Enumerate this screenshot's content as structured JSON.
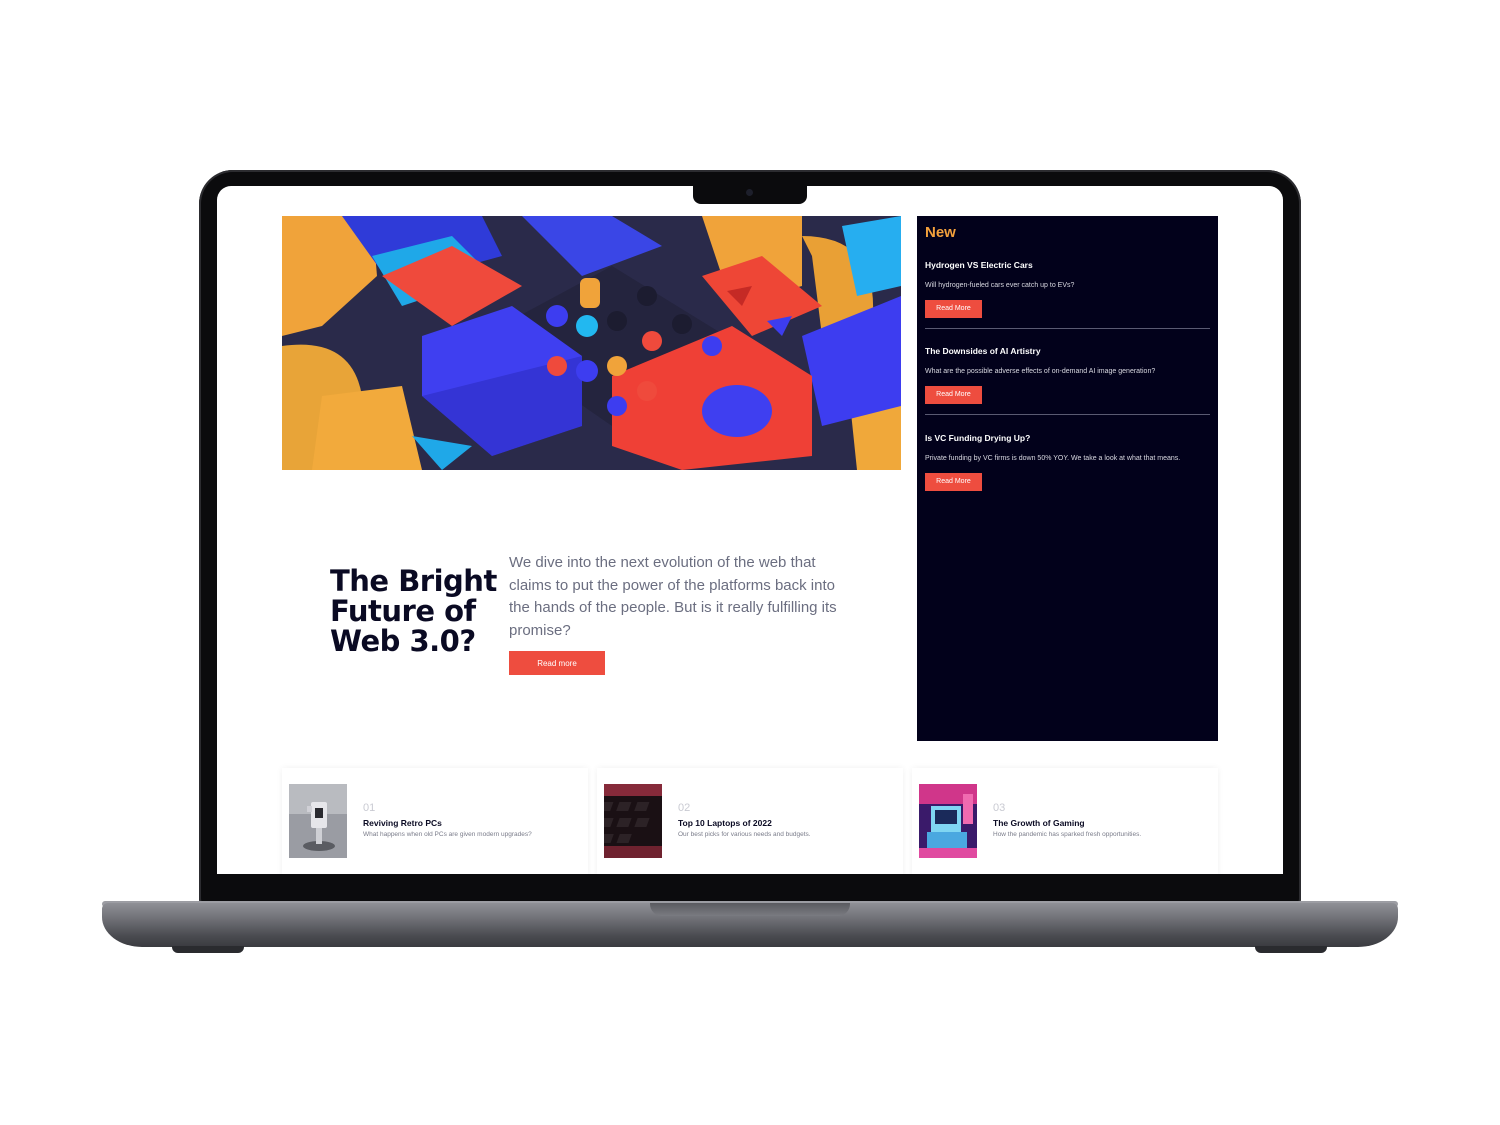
{
  "hero": {
    "title": "The Bright Future of Web 3.0?",
    "description": "We dive into the next evolution of the web that claims to put the power of the platforms back into the hands of the people. But is it really fulfilling its promise?",
    "button_label": "Read more"
  },
  "sidebar": {
    "heading": "New",
    "items": [
      {
        "title": "Hydrogen VS Electric Cars",
        "subtitle": "Will hydrogen-fueled cars ever catch up to EVs?",
        "button_label": "Read More"
      },
      {
        "title": "The Downsides of AI Artistry",
        "subtitle": "What are the possible adverse effects of on-demand AI image generation?",
        "button_label": "Read More"
      },
      {
        "title": "Is VC Funding Drying Up?",
        "subtitle": "Private funding by VC firms is down 50% YOY. We take a look at what that means.",
        "button_label": "Read More"
      }
    ]
  },
  "cards": [
    {
      "number": "01",
      "title": "Reviving Retro PCs",
      "description": "What happens when old PCs are given modern upgrades?"
    },
    {
      "number": "02",
      "title": "Top 10 Laptops of 2022",
      "description": "Our best picks for various needs and budgets."
    },
    {
      "number": "03",
      "title": "The Growth of Gaming",
      "description": "How the pandemic has sparked fresh opportunities."
    }
  ],
  "colors": {
    "accent": "#ee4d3f",
    "sidebar_bg": "#02011b",
    "sidebar_heading": "#f4a13c",
    "title_text": "#0a0a23"
  }
}
